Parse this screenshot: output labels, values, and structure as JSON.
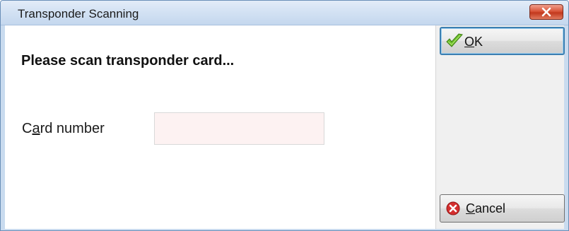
{
  "window": {
    "title": "Transponder Scanning"
  },
  "main": {
    "heading": "Please scan transponder card...",
    "card_number": {
      "label_pre": "C",
      "label_accel": "a",
      "label_post": "rd number",
      "value": "",
      "placeholder": ""
    }
  },
  "buttons": {
    "ok": {
      "accel": "O",
      "rest": "K",
      "icon": "checkmark-icon"
    },
    "cancel": {
      "accel": "C",
      "rest": "ancel",
      "icon": "cancel-x-icon"
    }
  },
  "colors": {
    "title_bar": "#d2e1f3",
    "close_button": "#c2381d",
    "input_background": "#fdf2f2",
    "ok_focus_border": "#3c7fb1"
  }
}
